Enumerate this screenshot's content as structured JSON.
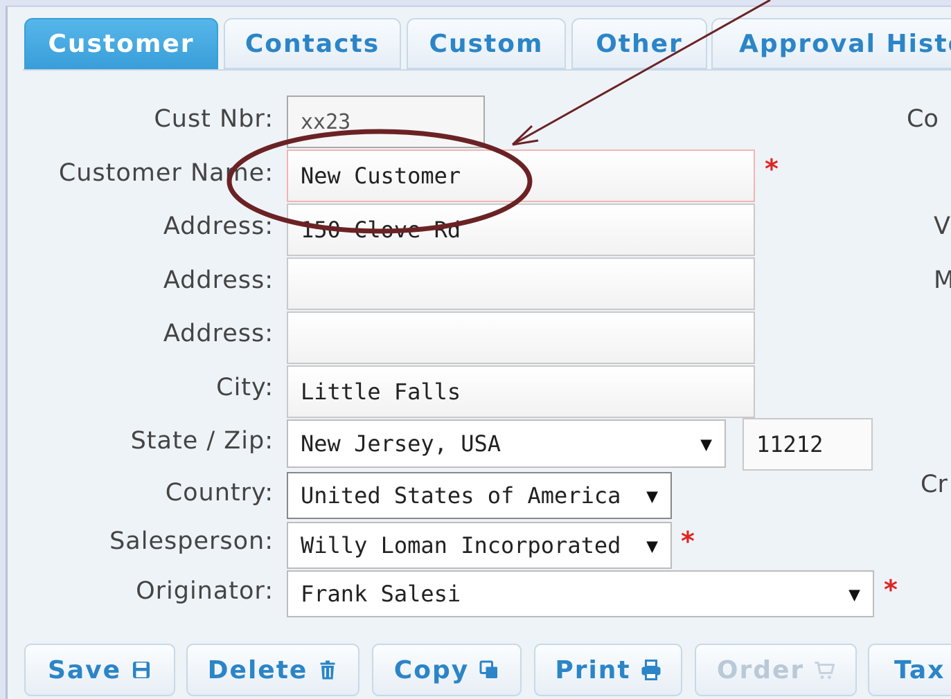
{
  "tabs": [
    {
      "label": "Customer",
      "active": true
    },
    {
      "label": "Contacts",
      "active": false
    },
    {
      "label": "Custom",
      "active": false
    },
    {
      "label": "Other",
      "active": false
    },
    {
      "label": "Approval Histo",
      "active": false
    }
  ],
  "form": {
    "cust_nbr": {
      "label": "Cust Nbr:",
      "value": "xx23"
    },
    "customer_name": {
      "label": "Customer Name:",
      "value": "New Customer"
    },
    "address1": {
      "label": "Address:",
      "value": "150 Clove Rd"
    },
    "address2": {
      "label": "Address:",
      "value": ""
    },
    "address3": {
      "label": "Address:",
      "value": ""
    },
    "city": {
      "label": "City:",
      "value": "Little Falls"
    },
    "state_zip": {
      "label": "State / Zip:",
      "state": "New Jersey, USA",
      "zip": "11212"
    },
    "country": {
      "label": "Country:",
      "value": "United States of America"
    },
    "salesperson": {
      "label": "Salesperson:",
      "value": "Willy Loman Incorporated"
    },
    "originator": {
      "label": "Originator:",
      "value": "Frank Salesi"
    },
    "required_marker": "*",
    "dropdown_caret": "▼"
  },
  "right_column_labels": [
    "Co",
    "V",
    "M",
    "Cr"
  ],
  "buttons": [
    {
      "label": "Save",
      "icon": "save-icon",
      "disabled": false
    },
    {
      "label": "Delete",
      "icon": "trash-icon",
      "disabled": false
    },
    {
      "label": "Copy",
      "icon": "copy-icon",
      "disabled": false
    },
    {
      "label": "Print",
      "icon": "print-icon",
      "disabled": false
    },
    {
      "label": "Order",
      "icon": "cart-icon",
      "disabled": true
    },
    {
      "label": "Tax",
      "icon": "",
      "disabled": false
    }
  ],
  "colors": {
    "accent": "#3a9fd9",
    "required": "#e02424",
    "annotation": "#6b2224"
  }
}
